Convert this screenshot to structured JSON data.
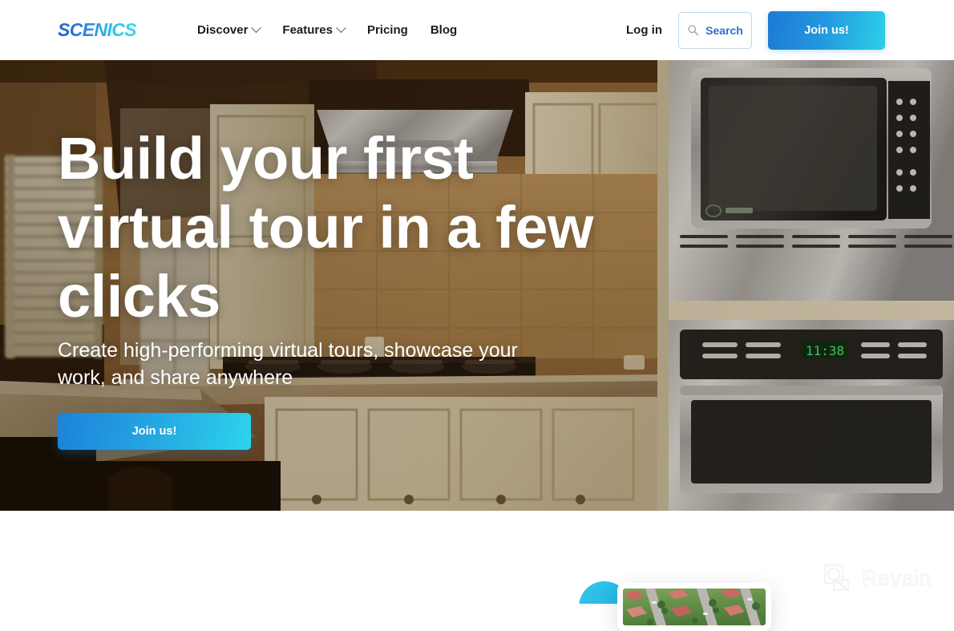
{
  "brand": {
    "name": "SCENICS",
    "gradient_from": "#1f62c8",
    "gradient_to": "#35dbe8"
  },
  "nav": {
    "items": [
      {
        "label": "Discover",
        "has_dropdown": true
      },
      {
        "label": "Features",
        "has_dropdown": true
      },
      {
        "label": "Pricing",
        "has_dropdown": false
      },
      {
        "label": "Blog",
        "has_dropdown": false
      }
    ],
    "login_label": "Log in",
    "search_label": "Search",
    "search_icon": "search-icon",
    "join_label": "Join us!",
    "join_gradient_from": "#1d7ad4",
    "join_gradient_to": "#2ccfe8"
  },
  "hero": {
    "title": "Build your first virtual tour in a few clicks",
    "subtitle": "Create high-performing virtual tours, showcase your work, and share anywhere",
    "cta_label": "Join us!",
    "cta_gradient_from": "#1d82d8",
    "cta_gradient_to": "#2dd4ea",
    "background_image": "kitchen-interior-photo"
  },
  "showcase": {
    "card_image": "aerial-neighborhood-photo",
    "accent_color": "#2ab6e4"
  },
  "watermark": {
    "text": "Revain",
    "icon": "revain-logo-icon",
    "color": "#e2e6ea"
  }
}
